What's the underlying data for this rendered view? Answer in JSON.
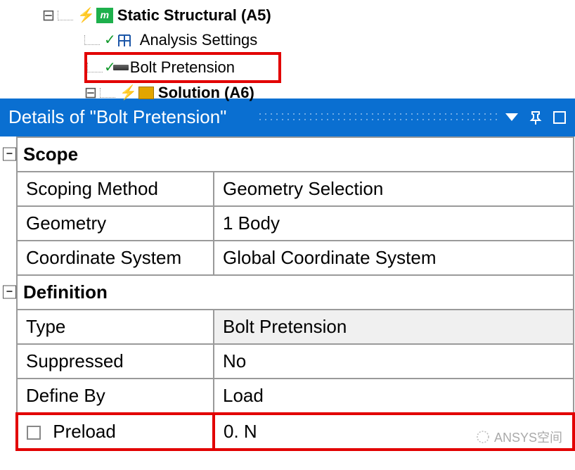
{
  "tree": {
    "root": {
      "label": "Static Structural (A5)"
    },
    "children": [
      {
        "label": "Analysis Settings"
      },
      {
        "label": "Bolt Pretension",
        "highlighted": true
      },
      {
        "label": "Solution (A6)"
      }
    ]
  },
  "details": {
    "title": "Details of \"Bolt Pretension\"",
    "sections": [
      {
        "name": "Scope",
        "rows": [
          {
            "label": "Scoping Method",
            "value": "Geometry Selection"
          },
          {
            "label": "Geometry",
            "value": "1 Body"
          },
          {
            "label": "Coordinate System",
            "value": "Global Coordinate System"
          }
        ]
      },
      {
        "name": "Definition",
        "rows": [
          {
            "label": "Type",
            "value": "Bolt Pretension",
            "readonly": true
          },
          {
            "label": "Suppressed",
            "value": "No"
          },
          {
            "label": "Define By",
            "value": "Load"
          },
          {
            "label": "Preload",
            "value": "0. N",
            "checkbox": true,
            "highlighted": true
          }
        ]
      }
    ]
  },
  "watermark": "ANSYS空间"
}
